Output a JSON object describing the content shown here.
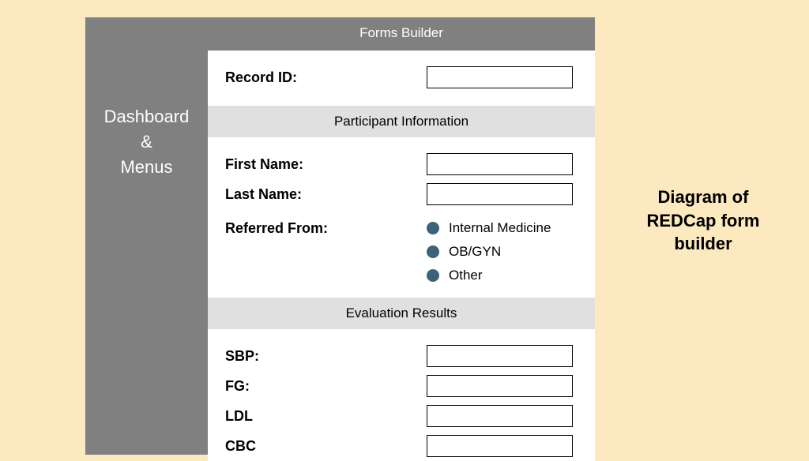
{
  "sidebar": {
    "label": "Dashboard\n&\nMenus"
  },
  "header": {
    "title": "Forms Builder"
  },
  "record": {
    "label": "Record ID:"
  },
  "participant": {
    "header": "Participant Information",
    "first_name_label": "First Name:",
    "last_name_label": "Last Name:",
    "referred_label": "Referred From:",
    "referred_options": [
      "Internal Medicine",
      "OB/GYN",
      "Other"
    ]
  },
  "evaluation": {
    "header": "Evaluation Results",
    "fields": [
      "SBP:",
      "FG:",
      "LDL",
      "CBC"
    ]
  },
  "caption": "Diagram of REDCap form builder"
}
